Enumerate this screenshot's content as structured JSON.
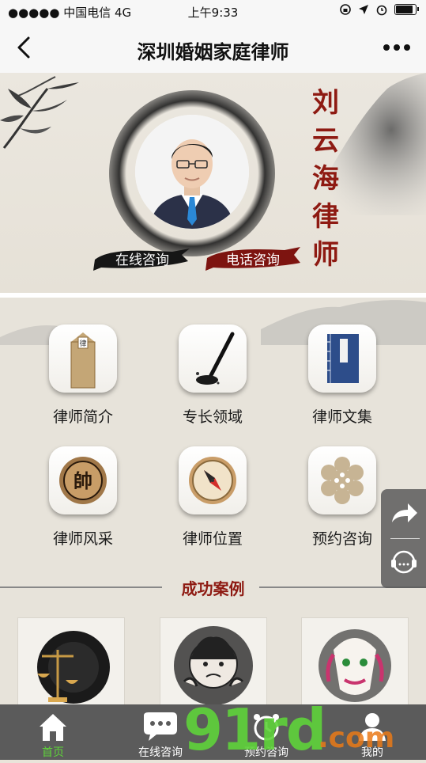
{
  "status_bar": {
    "carrier": "●●●●● 中国电信  4G",
    "time": "上午9:33"
  },
  "nav": {
    "title": "深圳婚姻家庭律师"
  },
  "hero": {
    "name_chars": [
      "刘",
      "云",
      "海",
      "律",
      "师"
    ],
    "online_button": "在线咨询",
    "phone_button": "电话咨询"
  },
  "menu": [
    {
      "label": "律师简介",
      "icon": "lawyer-plaque-icon"
    },
    {
      "label": "专长领域",
      "icon": "brush-inkstone-icon"
    },
    {
      "label": "律师文集",
      "icon": "book-icon"
    },
    {
      "label": "律师风采",
      "icon": "chess-piece-icon"
    },
    {
      "label": "律师位置",
      "icon": "compass-icon"
    },
    {
      "label": "预约咨询",
      "icon": "flower-icon"
    }
  ],
  "cases": {
    "title": "成功案例"
  },
  "tabs": [
    {
      "label": "首页",
      "icon": "home-icon"
    },
    {
      "label": "在线咨询",
      "icon": "chat-icon"
    },
    {
      "label": "预约咨询",
      "icon": "alarm-icon"
    },
    {
      "label": "我的",
      "icon": "user-icon"
    }
  ],
  "watermark": {
    "main": "91rd",
    "suffix": ".com"
  },
  "colors": {
    "accent": "#8e1a12",
    "tab_active": "#5fd33a",
    "tabbar": "#5b5b5b"
  }
}
